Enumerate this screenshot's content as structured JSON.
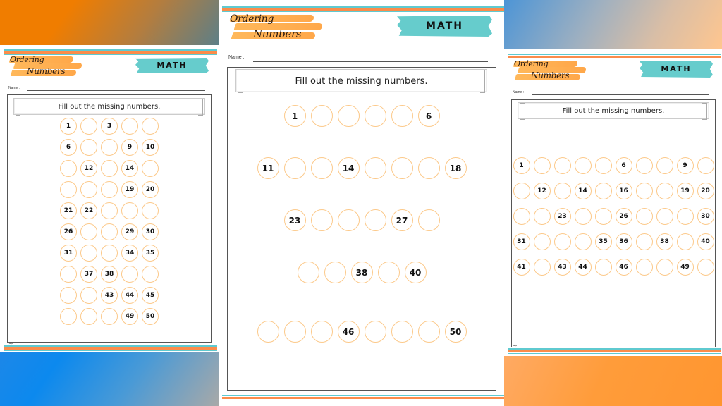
{
  "colors": {
    "circle_border": "#fcc98a",
    "math_tag": "#66cccc",
    "stripe_orange": "#fb8c4a",
    "stripe_teal": "#5fcad0",
    "brush_orange": "#ffa83f"
  },
  "worksheets": [
    {
      "id": "left",
      "logo": {
        "line1": "Ordering",
        "line2": "Numbers"
      },
      "subject_tag": "MATH",
      "name_label": "Name :",
      "instruction": "Fill out the missing numbers.",
      "rows": [
        [
          "1",
          "",
          "3",
          "",
          ""
        ],
        [
          "6",
          "",
          "",
          "9",
          "10"
        ],
        [
          "",
          "12",
          "",
          "14",
          ""
        ],
        [
          "",
          "",
          "",
          "19",
          "20"
        ],
        [
          "21",
          "22",
          "",
          "",
          ""
        ],
        [
          "26",
          "",
          "",
          "29",
          "30"
        ],
        [
          "31",
          "",
          "",
          "34",
          "35"
        ],
        [
          "",
          "37",
          "38",
          "",
          ""
        ],
        [
          "",
          "",
          "43",
          "44",
          "45"
        ],
        [
          "",
          "",
          "",
          "49",
          "50"
        ]
      ]
    },
    {
      "id": "middle",
      "logo": {
        "line1": "Ordering",
        "line2": "Numbers"
      },
      "subject_tag": "MATH",
      "name_label": "Name :",
      "instruction": "Fill out the missing numbers.",
      "rows": [
        [
          "1",
          "",
          "",
          "",
          "",
          "6"
        ],
        [
          "11",
          "",
          "",
          "14",
          "",
          "",
          "",
          "18"
        ],
        [
          "23",
          "",
          "",
          "",
          "27",
          ""
        ],
        [
          "",
          "",
          "38",
          "",
          "40"
        ],
        [
          "",
          "",
          "",
          "46",
          "",
          "",
          "",
          "50"
        ]
      ]
    },
    {
      "id": "right",
      "logo": {
        "line1": "Ordering",
        "line2": "Numbers"
      },
      "subject_tag": "MATH",
      "name_label": "Name :",
      "instruction": "Fill out the missing numbers.",
      "rows": [
        [
          "1",
          "",
          "",
          "",
          "",
          "6",
          "",
          "",
          "9",
          ""
        ],
        [
          "",
          "12",
          "",
          "14",
          "",
          "16",
          "",
          "",
          "19",
          "20"
        ],
        [
          "",
          "",
          "23",
          "",
          "",
          "26",
          "",
          "",
          "",
          "30"
        ],
        [
          "31",
          "",
          "",
          "",
          "35",
          "36",
          "",
          "38",
          "",
          "40"
        ],
        [
          "41",
          "",
          "43",
          "44",
          "",
          "46",
          "",
          "",
          "49",
          ""
        ]
      ]
    }
  ]
}
